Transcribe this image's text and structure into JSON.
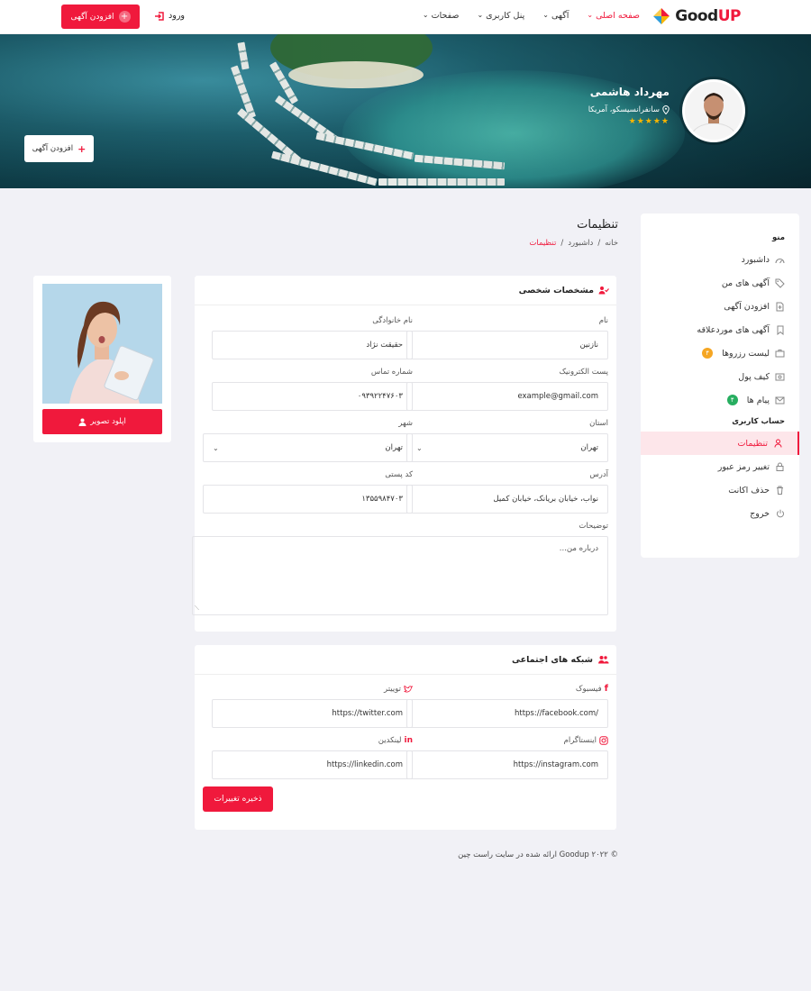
{
  "header": {
    "logo_text_a": "Good",
    "logo_text_b": "UP",
    "nav": [
      {
        "label": "صفحه اصلی",
        "active": true
      },
      {
        "label": "آگهی",
        "active": false
      },
      {
        "label": "پنل کاربری",
        "active": false
      },
      {
        "label": "صفحات",
        "active": false
      }
    ],
    "login_label": "ورود",
    "add_ad_label": "افزودن آگهی",
    "accent_color": "#f0193c"
  },
  "hero": {
    "name": "مهرداد هاشمی",
    "location": "سانفرانسیسکو، آمریکا",
    "stars": "★★★★★",
    "add_ad_label": "افزودن آگهی"
  },
  "sidebar": {
    "menu_title": "منو",
    "items": [
      {
        "label": "داشبورد",
        "icon": "gauge-icon"
      },
      {
        "label": "آگهی های من",
        "icon": "tags-icon"
      },
      {
        "label": "افزودن آگهی",
        "icon": "file-plus-icon"
      },
      {
        "label": "آگهی های موردعلاقه",
        "icon": "bookmark-icon"
      },
      {
        "label": "لیست رزروها",
        "icon": "briefcase-icon",
        "badge": "۴"
      },
      {
        "label": "کیف پول",
        "icon": "wallet-icon"
      },
      {
        "label": "پیام ها",
        "icon": "mail-icon",
        "badge": "۴"
      }
    ],
    "account_title": "حساب کاربری",
    "account_items": [
      {
        "label": "تنظیمات",
        "icon": "user-icon",
        "active": true
      },
      {
        "label": "تغییر رمز عبور",
        "icon": "lock-icon"
      },
      {
        "label": "حذف اکانت",
        "icon": "trash-icon"
      },
      {
        "label": "خروج",
        "icon": "power-icon"
      }
    ]
  },
  "page": {
    "title": "تنظیمات",
    "breadcrumb": [
      "خانه",
      "داشبورد",
      "تنظیمات"
    ],
    "breadcrumb_sep": "/"
  },
  "personal": {
    "title": "مشخصات شخصی",
    "first_name_label": "نام",
    "first_name_value": "نازنین",
    "last_name_label": "نام خانوادگی",
    "last_name_value": "حقیقت نژاد",
    "email_label": "پست الکترونیک",
    "email_value": "example@gmail.com",
    "phone_label": "شماره تماس",
    "phone_value": "۰۹۳۹۲۲۴۷۶۰۳",
    "province_label": "استان",
    "province_value": "تهران",
    "city_label": "شهر",
    "city_value": "تهران",
    "address_label": "آدرس",
    "address_value": "نواب، خیابان بریانک، خیابان کمیل",
    "postal_label": "کد پستی",
    "postal_value": "۱۳۵۵۹۸۴۷۰۳",
    "desc_label": "توضیحات",
    "desc_placeholder": "درباره من..."
  },
  "social": {
    "title": "شبکه های اجتماعی",
    "facebook_label": "فیسبوک",
    "facebook_value": "https://facebook.com/",
    "twitter_label": "توییتر",
    "twitter_value": "https://twitter.com",
    "instagram_label": "اینستاگرام",
    "instagram_value": "https://instagram.com",
    "linkedin_label": "لینکدین",
    "linkedin_value": "https://linkedin.com",
    "save_label": "ذخیره تغییرات"
  },
  "avatar": {
    "upload_label": "اپلود تصویر"
  },
  "footer": {
    "text": "© ۲۰۲۲ Goodup ارائه شده در سایت راست چین"
  }
}
